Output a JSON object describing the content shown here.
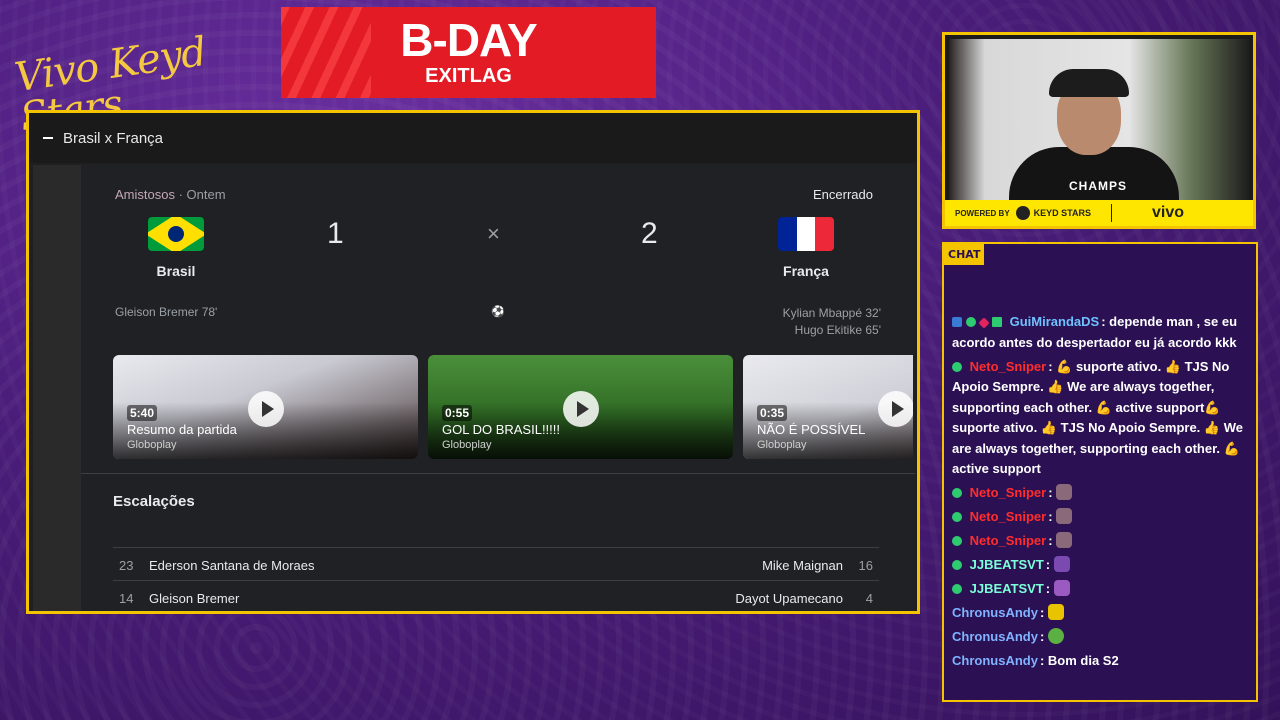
{
  "overlay": {
    "logo_text": "Vivo Keyd Stars",
    "banner": {
      "title": "B-DAY",
      "subtitle": "EXITLAG"
    }
  },
  "match": {
    "header_title": "Brasil x França",
    "league": "Amistosos",
    "date": "· Ontem",
    "status": "Encerrado",
    "home": {
      "name": "Brasil",
      "score": "1",
      "scorers": [
        "Gleison Bremer 78'"
      ]
    },
    "away": {
      "name": "França",
      "score": "2",
      "scorers": [
        "Kylian Mbappé 32'",
        "Hugo Ekitike 65'"
      ]
    },
    "vs_symbol": "×",
    "ball_symbol": "⚽",
    "videos": [
      {
        "duration": "5:40",
        "title": "Resumo da partida",
        "source": "Globoplay"
      },
      {
        "duration": "0:55",
        "title": "GOL DO BRASIL!!!!!",
        "source": "Globoplay"
      },
      {
        "duration": "0:35",
        "title": "NÃO É POSSÍVEL",
        "source": "Globoplay"
      }
    ],
    "lineups_title": "Escalações",
    "lineups": [
      {
        "home_num": "23",
        "home_player": "Ederson Santana de Moraes",
        "away_player": "Mike Maignan",
        "away_num": "16"
      },
      {
        "home_num": "14",
        "home_player": "Gleison Bremer",
        "away_player": "Dayot Upamecano",
        "away_num": "4"
      }
    ]
  },
  "webcam": {
    "tag": "CHAMPS",
    "powered_by": "POWERED BY",
    "sponsor_keyd": "KEYD STARS",
    "sponsor_vivo": "vivo"
  },
  "chat": {
    "tag": "CHAT",
    "messages": [
      {
        "user": "GuiMirandaDS",
        "color": "#6ec1ff",
        "text": ": depende man , se eu acordo antes do despertador eu já acordo kkk"
      },
      {
        "user": "Neto_Sniper",
        "color": "#ff2d2d",
        "text": ": 💪 suporte ativo. 👍 TJS No Apoio Sempre. 👍 We are always together, supporting each other. 💪 active support💪 suporte ativo. 👍 TJS No Apoio Sempre. 👍 We are always together, supporting each other. 💪 active support"
      },
      {
        "user": "Neto_Sniper",
        "color": "#ff2d2d",
        "text": ":"
      },
      {
        "user": "Neto_Sniper",
        "color": "#ff2d2d",
        "text": ":"
      },
      {
        "user": "Neto_Sniper",
        "color": "#ff2d2d",
        "text": ":"
      },
      {
        "user": "JJBEATSVT",
        "color": "#7cffd8",
        "text": ":"
      },
      {
        "user": "JJBEATSVT",
        "color": "#7cffd8",
        "text": ":"
      },
      {
        "user": "ChronusAndy",
        "color": "#7fb3ff",
        "text": ":"
      },
      {
        "user": "ChronusAndy",
        "color": "#7fb3ff",
        "text": ":"
      },
      {
        "user": "ChronusAndy",
        "color": "#7fb3ff",
        "text": ": Bom dia S2"
      }
    ]
  },
  "colors": {
    "frame_border": "#f5c400",
    "banner_red": "#e21b24",
    "france_blue": "#002395",
    "france_red": "#ed2939"
  }
}
